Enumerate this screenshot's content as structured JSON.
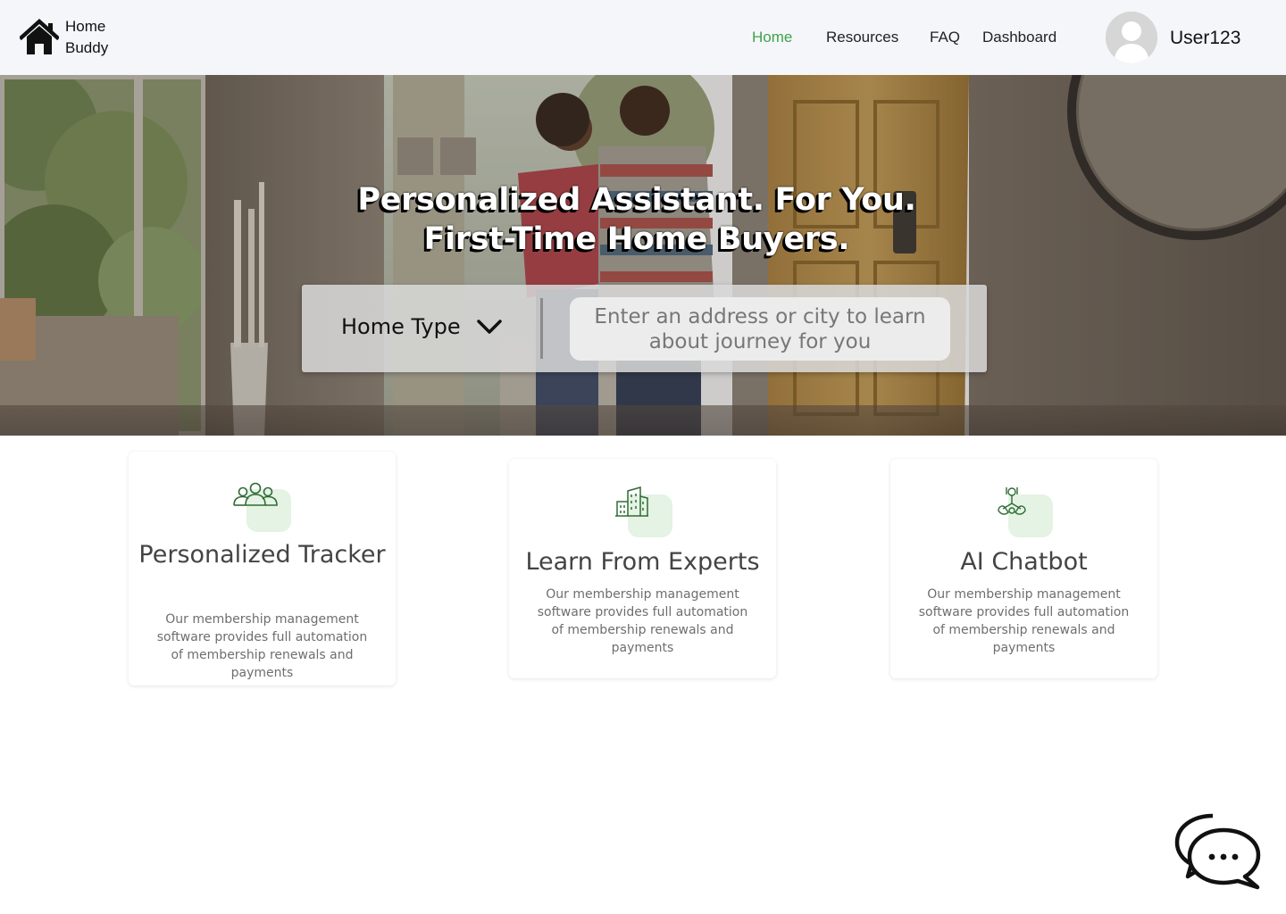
{
  "brand": {
    "name_line1": "Home",
    "name_line2": "Buddy",
    "logo_icon": "house-icon"
  },
  "nav": {
    "items": [
      {
        "label": "Home",
        "active": true
      },
      {
        "label": "Resources",
        "active": false
      },
      {
        "label": "FAQ",
        "active": false
      },
      {
        "label": "Dashboard",
        "active": false
      }
    ],
    "active_color": "#3ea34a"
  },
  "user": {
    "name": "User123",
    "avatar_icon": "user-avatar-icon"
  },
  "hero": {
    "title_line1": "Personalized Assistant. For You.",
    "title_line2": "First-Time Home Buyers.",
    "home_type_label": "Home Type",
    "search_placeholder": "Enter an address or city to learn about journey for you"
  },
  "features": [
    {
      "icon": "people-group-icon",
      "title": "Personalized Tracker",
      "description": "Our membership management software provides full automation of membership renewals and payments"
    },
    {
      "icon": "buildings-icon",
      "title": "Learn From Experts",
      "description": "Our membership management software provides full automation of membership renewals and payments"
    },
    {
      "icon": "network-hands-icon",
      "title": "AI Chatbot",
      "description": "Our membership management software provides full automation of membership renewals and payments"
    }
  ],
  "colors": {
    "header_bg": "#f5f6fa",
    "icon_accent": "#2e6b35",
    "icon_bg": "#e4f3e3"
  },
  "chat": {
    "icon": "chat-bubbles-icon"
  }
}
